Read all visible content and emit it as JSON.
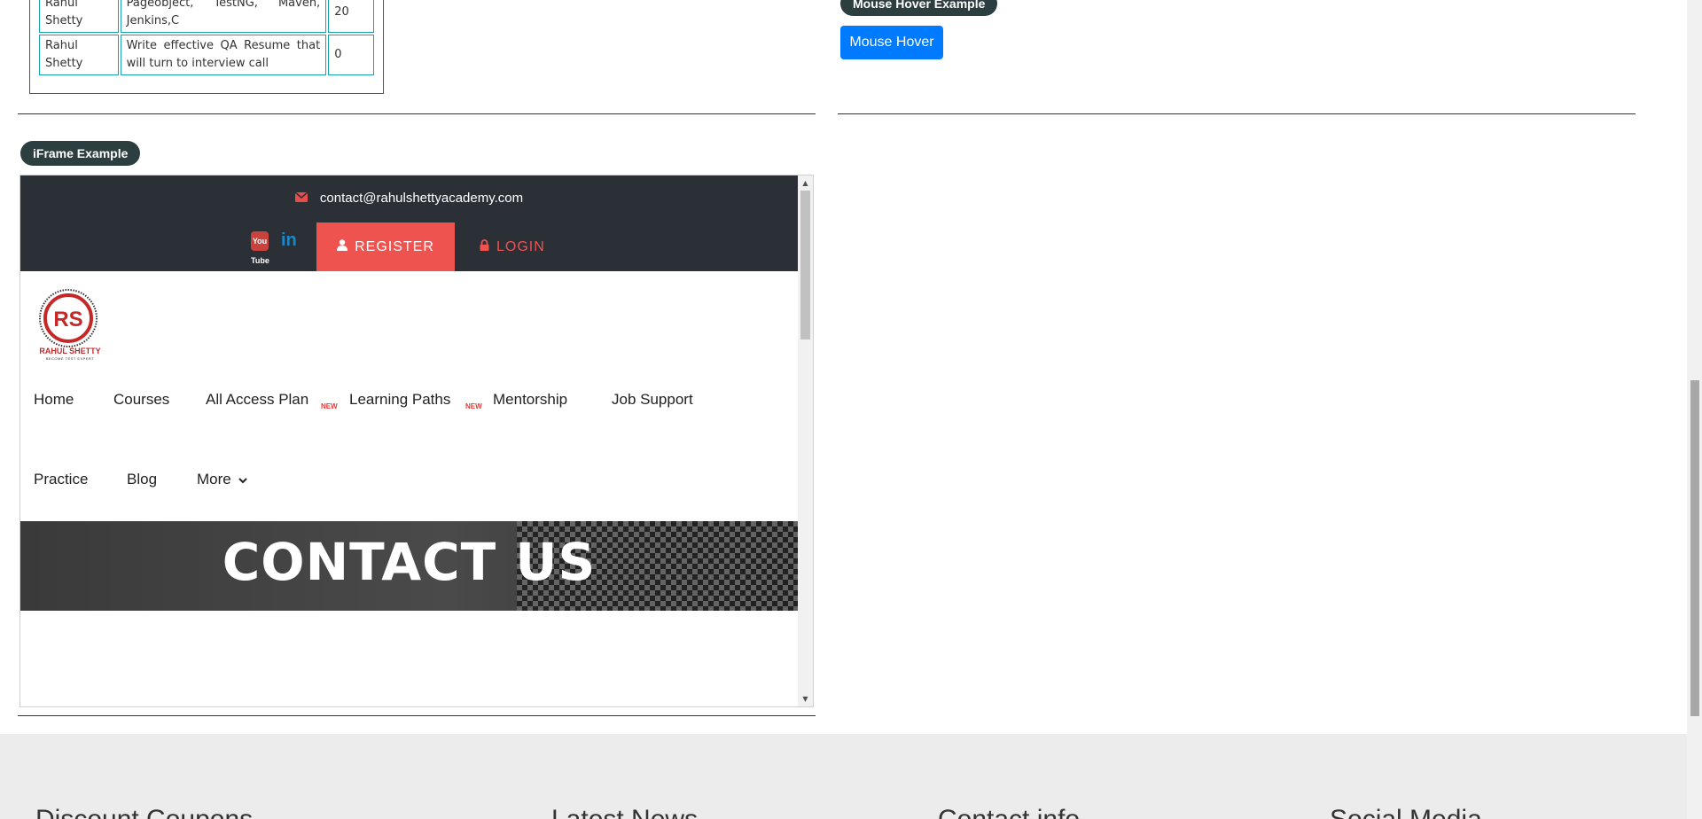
{
  "table": {
    "rows": [
      {
        "instructor": "Rahul Shetty",
        "course": "Pageobject, TestNG, Maven, Jenkins,C",
        "price": "20"
      },
      {
        "instructor": "Rahul Shetty",
        "course": "Write effective QA Resume that will turn to interview call",
        "price": "0"
      }
    ]
  },
  "mouse_hover": {
    "badge": "Mouse Hover Example",
    "button_label": "Mouse Hover"
  },
  "iframe_section": {
    "badge": "iFrame Example",
    "email": "contact@rahulshettyacademy.com",
    "youtube_label": "You Tube",
    "linkedin_label": "in",
    "register_label": "REGISTER",
    "login_label": "LOGIN",
    "logo_text": "RAHUL SHETTY",
    "logo_tagline": "BECOME TEST EXPERT",
    "logo_monogram": "RS",
    "nav": {
      "home": "Home",
      "courses": "Courses",
      "all_access": "All Access Plan",
      "learning_paths": "Learning Paths",
      "mentorship": "Mentorship",
      "job_support": "Job Support",
      "practice": "Practice",
      "blog": "Blog",
      "more": "More",
      "new_tag": "NEW"
    },
    "hero_title": "CONTACT US"
  },
  "footer": {
    "headings": [
      "Discount Coupons",
      "Latest News",
      "Contact info",
      "Social Media"
    ]
  },
  "colors": {
    "badge_bg": "#2c3e3f",
    "hover_button": "#007bff",
    "iframe_topbar": "#2b2f36",
    "register_bg": "#ef5350",
    "table_border": "#17a2b8",
    "footer_bg": "#ececec"
  },
  "icons": [
    "envelope-icon",
    "youtube-icon",
    "linkedin-icon",
    "user-icon",
    "lock-icon",
    "chevron-down-icon"
  ]
}
